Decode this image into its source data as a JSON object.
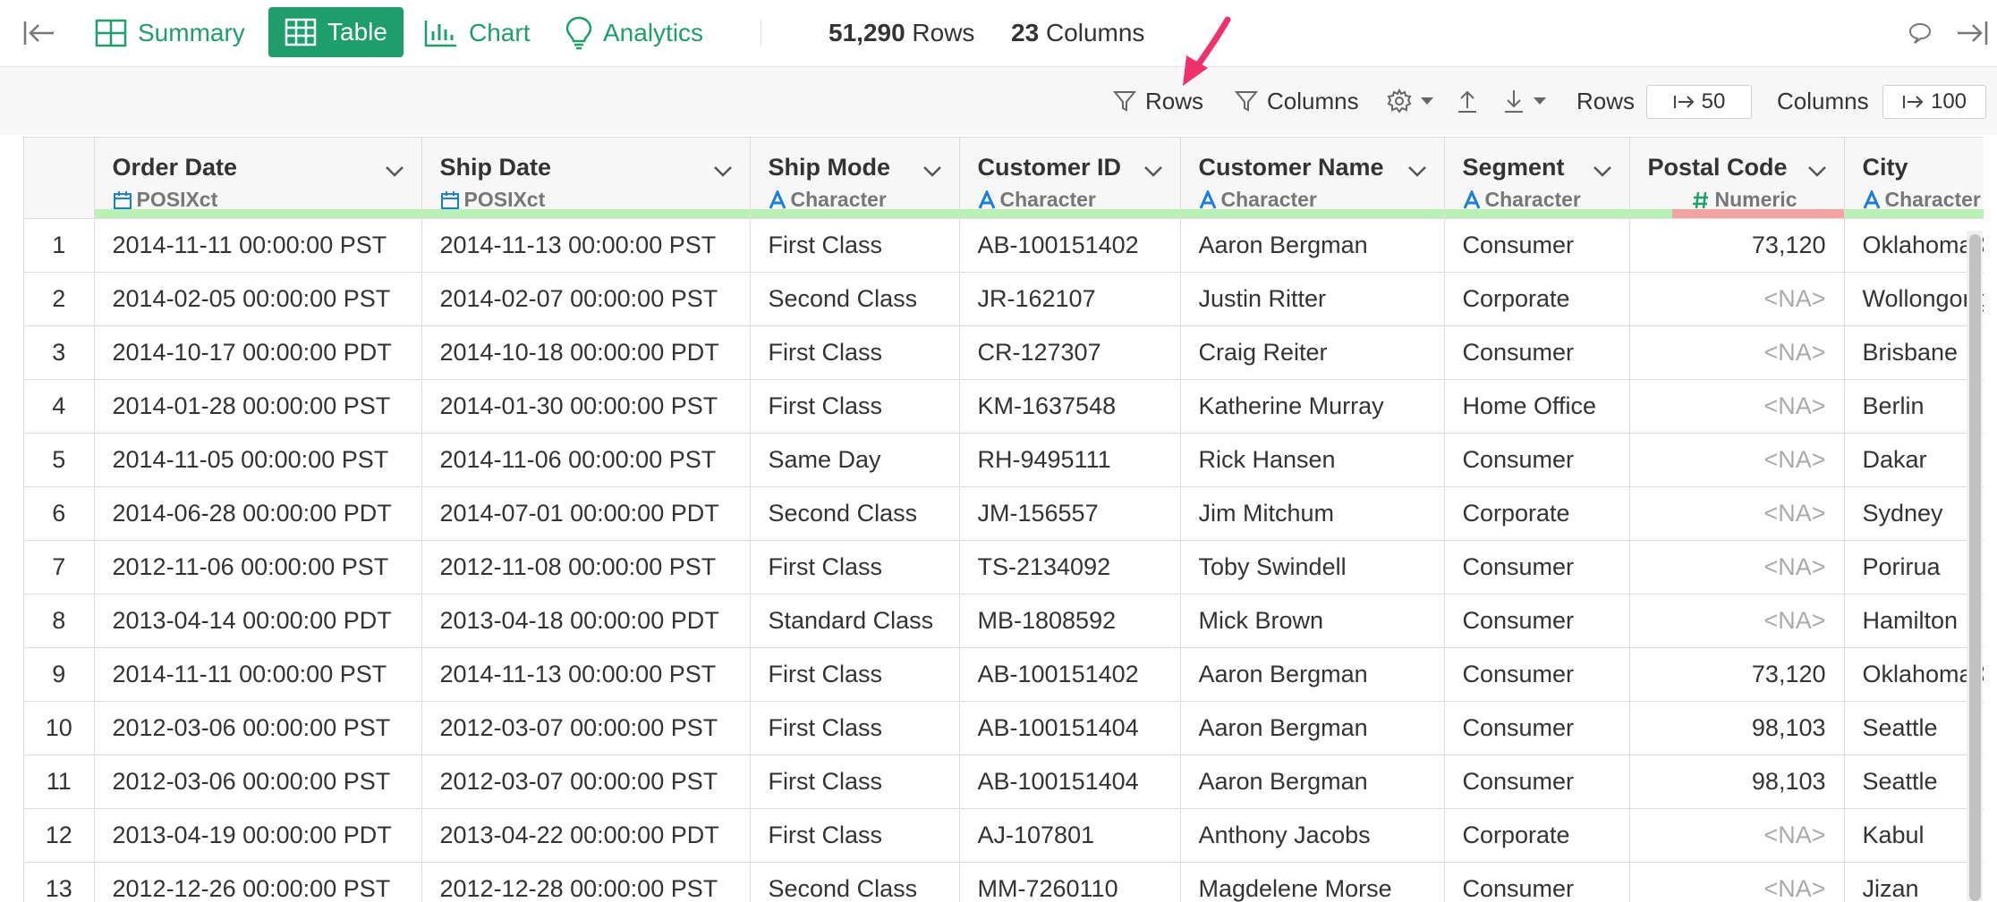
{
  "header": {
    "tabs": [
      {
        "label": "Summary"
      },
      {
        "label": "Table"
      },
      {
        "label": "Chart"
      },
      {
        "label": "Analytics"
      }
    ],
    "rows_count": "51,290",
    "rows_label": "Rows",
    "cols_count": "23",
    "cols_label": "Columns"
  },
  "toolbar": {
    "filter_rows": "Rows",
    "filter_columns": "Columns",
    "rows_label": "Rows",
    "rows_page": "50",
    "columns_label": "Columns",
    "columns_page": "100"
  },
  "colors": {
    "accent": "#1e9e6a",
    "arrow": "#f0306a",
    "quality_ok": "#b9f0b3",
    "quality_na": "#f3a3a1"
  },
  "table": {
    "columns": [
      {
        "name": "Order Date",
        "type": "POSIXct",
        "icon": "calendar-icon"
      },
      {
        "name": "Ship Date",
        "type": "POSIXct",
        "icon": "calendar-icon"
      },
      {
        "name": "Ship Mode",
        "type": "Character",
        "icon": "character-icon"
      },
      {
        "name": "Customer ID",
        "type": "Character",
        "icon": "character-icon"
      },
      {
        "name": "Customer Name",
        "type": "Character",
        "icon": "character-icon"
      },
      {
        "name": "Segment",
        "type": "Character",
        "icon": "character-icon"
      },
      {
        "name": "Postal Code",
        "type": "Numeric",
        "icon": "numeric-icon"
      },
      {
        "name": "City",
        "type": "Character",
        "icon": "character-icon"
      }
    ],
    "rows": [
      {
        "n": "1",
        "order": "2014-11-11 00:00:00 PST",
        "ship": "2014-11-13 00:00:00 PST",
        "mode": "First Class",
        "cid": "AB-100151402",
        "cname": "Aaron Bergman",
        "segment": "Consumer",
        "postal": "73,120",
        "city": "Oklahoma City"
      },
      {
        "n": "2",
        "order": "2014-02-05 00:00:00 PST",
        "ship": "2014-02-07 00:00:00 PST",
        "mode": "Second Class",
        "cid": "JR-162107",
        "cname": "Justin Ritter",
        "segment": "Corporate",
        "postal": "<NA>",
        "city": "Wollongong"
      },
      {
        "n": "3",
        "order": "2014-10-17 00:00:00 PDT",
        "ship": "2014-10-18 00:00:00 PDT",
        "mode": "First Class",
        "cid": "CR-127307",
        "cname": "Craig Reiter",
        "segment": "Consumer",
        "postal": "<NA>",
        "city": "Brisbane"
      },
      {
        "n": "4",
        "order": "2014-01-28 00:00:00 PST",
        "ship": "2014-01-30 00:00:00 PST",
        "mode": "First Class",
        "cid": "KM-1637548",
        "cname": "Katherine Murray",
        "segment": "Home Office",
        "postal": "<NA>",
        "city": "Berlin"
      },
      {
        "n": "5",
        "order": "2014-11-05 00:00:00 PST",
        "ship": "2014-11-06 00:00:00 PST",
        "mode": "Same Day",
        "cid": "RH-9495111",
        "cname": "Rick Hansen",
        "segment": "Consumer",
        "postal": "<NA>",
        "city": "Dakar"
      },
      {
        "n": "6",
        "order": "2014-06-28 00:00:00 PDT",
        "ship": "2014-07-01 00:00:00 PDT",
        "mode": "Second Class",
        "cid": "JM-156557",
        "cname": "Jim Mitchum",
        "segment": "Corporate",
        "postal": "<NA>",
        "city": "Sydney"
      },
      {
        "n": "7",
        "order": "2012-11-06 00:00:00 PST",
        "ship": "2012-11-08 00:00:00 PST",
        "mode": "First Class",
        "cid": "TS-2134092",
        "cname": "Toby Swindell",
        "segment": "Consumer",
        "postal": "<NA>",
        "city": "Porirua"
      },
      {
        "n": "8",
        "order": "2013-04-14 00:00:00 PDT",
        "ship": "2013-04-18 00:00:00 PDT",
        "mode": "Standard Class",
        "cid": "MB-1808592",
        "cname": "Mick Brown",
        "segment": "Consumer",
        "postal": "<NA>",
        "city": "Hamilton"
      },
      {
        "n": "9",
        "order": "2014-11-11 00:00:00 PST",
        "ship": "2014-11-13 00:00:00 PST",
        "mode": "First Class",
        "cid": "AB-100151402",
        "cname": "Aaron Bergman",
        "segment": "Consumer",
        "postal": "73,120",
        "city": "Oklahoma City"
      },
      {
        "n": "10",
        "order": "2012-03-06 00:00:00 PST",
        "ship": "2012-03-07 00:00:00 PST",
        "mode": "First Class",
        "cid": "AB-100151404",
        "cname": "Aaron Bergman",
        "segment": "Consumer",
        "postal": "98,103",
        "city": "Seattle"
      },
      {
        "n": "11",
        "order": "2012-03-06 00:00:00 PST",
        "ship": "2012-03-07 00:00:00 PST",
        "mode": "First Class",
        "cid": "AB-100151404",
        "cname": "Aaron Bergman",
        "segment": "Consumer",
        "postal": "98,103",
        "city": "Seattle"
      },
      {
        "n": "12",
        "order": "2013-04-19 00:00:00 PDT",
        "ship": "2013-04-22 00:00:00 PDT",
        "mode": "First Class",
        "cid": "AJ-107801",
        "cname": "Anthony Jacobs",
        "segment": "Corporate",
        "postal": "<NA>",
        "city": "Kabul"
      },
      {
        "n": "13",
        "order": "2012-12-26 00:00:00 PST",
        "ship": "2012-12-28 00:00:00 PST",
        "mode": "Second Class",
        "cid": "MM-7260110",
        "cname": "Magdelene Morse",
        "segment": "Consumer",
        "postal": "<NA>",
        "city": "Jizan"
      }
    ]
  }
}
